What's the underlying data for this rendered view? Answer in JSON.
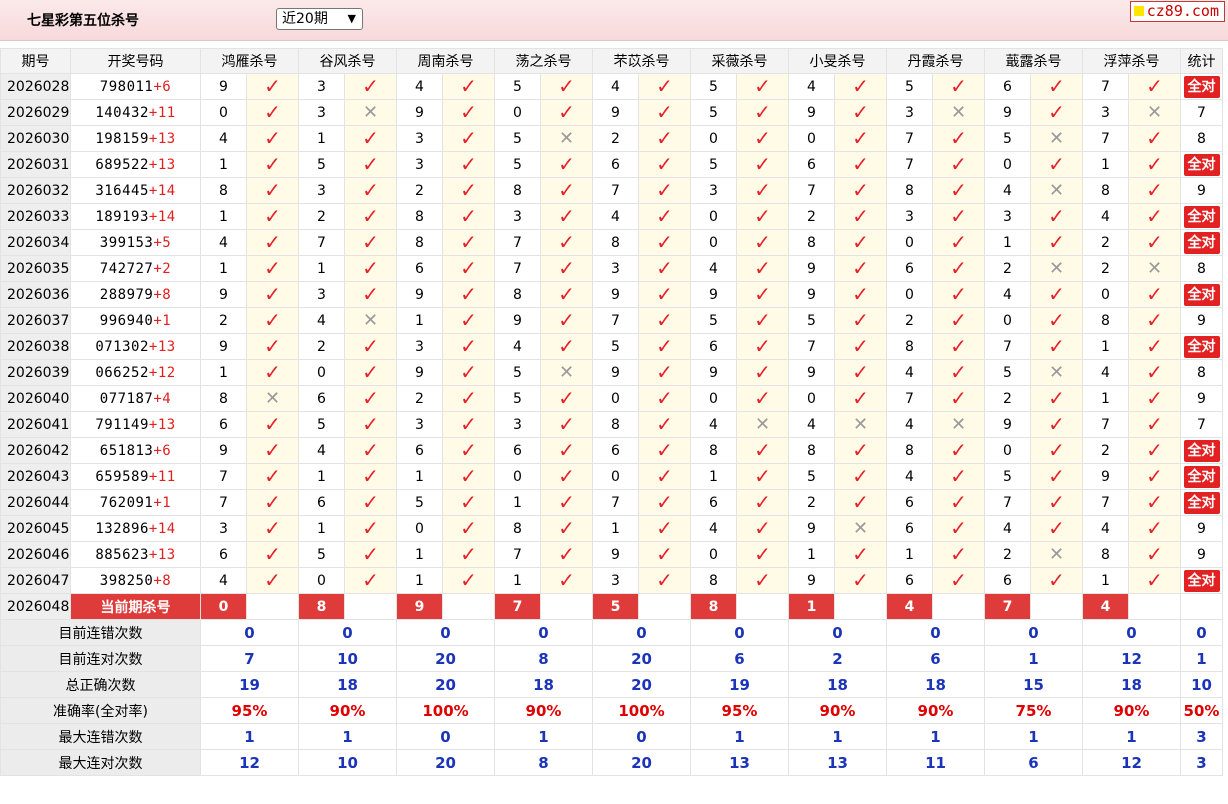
{
  "header": {
    "title": "七星彩第五位杀号",
    "range_select": "近20期",
    "logo_text": "cz89.com"
  },
  "table": {
    "columns": {
      "issue": "期号",
      "draw": "开奖号码",
      "stats": "统计",
      "experts": [
        "鸿雁杀号",
        "谷风杀号",
        "周南杀号",
        "荡之杀号",
        "芣苡杀号",
        "采薇杀号",
        "小旻杀号",
        "丹霞杀号",
        "蕺露杀号",
        "浮萍杀号"
      ]
    },
    "rows": [
      {
        "issue": "2026028",
        "main": "798011",
        "extra": "+6",
        "picks": [
          "9",
          "3",
          "4",
          "5",
          "4",
          "5",
          "4",
          "5",
          "6",
          "7"
        ],
        "marks": [
          "ok",
          "ok",
          "ok",
          "ok",
          "ok",
          "ok",
          "ok",
          "ok",
          "ok",
          "ok"
        ],
        "stat": "全对"
      },
      {
        "issue": "2026029",
        "main": "140432",
        "extra": "+11",
        "picks": [
          "0",
          "3",
          "9",
          "0",
          "9",
          "5",
          "9",
          "3",
          "9",
          "3"
        ],
        "marks": [
          "ok",
          "bad",
          "ok",
          "ok",
          "ok",
          "ok",
          "ok",
          "bad",
          "ok",
          "bad"
        ],
        "stat": "7"
      },
      {
        "issue": "2026030",
        "main": "198159",
        "extra": "+13",
        "picks": [
          "4",
          "1",
          "3",
          "5",
          "2",
          "0",
          "0",
          "7",
          "5",
          "7"
        ],
        "marks": [
          "ok",
          "ok",
          "ok",
          "bad",
          "ok",
          "ok",
          "ok",
          "ok",
          "bad",
          "ok"
        ],
        "stat": "8"
      },
      {
        "issue": "2026031",
        "main": "689522",
        "extra": "+13",
        "picks": [
          "1",
          "5",
          "3",
          "5",
          "6",
          "5",
          "6",
          "7",
          "0",
          "1"
        ],
        "marks": [
          "ok",
          "ok",
          "ok",
          "ok",
          "ok",
          "ok",
          "ok",
          "ok",
          "ok",
          "ok"
        ],
        "stat": "全对"
      },
      {
        "issue": "2026032",
        "main": "316445",
        "extra": "+14",
        "picks": [
          "8",
          "3",
          "2",
          "8",
          "7",
          "3",
          "7",
          "8",
          "4",
          "8"
        ],
        "marks": [
          "ok",
          "ok",
          "ok",
          "ok",
          "ok",
          "ok",
          "ok",
          "ok",
          "bad",
          "ok"
        ],
        "stat": "9"
      },
      {
        "issue": "2026033",
        "main": "189193",
        "extra": "+14",
        "picks": [
          "1",
          "2",
          "8",
          "3",
          "4",
          "0",
          "2",
          "3",
          "3",
          "4"
        ],
        "marks": [
          "ok",
          "ok",
          "ok",
          "ok",
          "ok",
          "ok",
          "ok",
          "ok",
          "ok",
          "ok"
        ],
        "stat": "全对"
      },
      {
        "issue": "2026034",
        "main": "399153",
        "extra": "+5",
        "picks": [
          "4",
          "7",
          "8",
          "7",
          "8",
          "0",
          "8",
          "0",
          "1",
          "2"
        ],
        "marks": [
          "ok",
          "ok",
          "ok",
          "ok",
          "ok",
          "ok",
          "ok",
          "ok",
          "ok",
          "ok"
        ],
        "stat": "全对"
      },
      {
        "issue": "2026035",
        "main": "742727",
        "extra": "+2",
        "picks": [
          "1",
          "1",
          "6",
          "7",
          "3",
          "4",
          "9",
          "6",
          "2",
          "2"
        ],
        "marks": [
          "ok",
          "ok",
          "ok",
          "ok",
          "ok",
          "ok",
          "ok",
          "ok",
          "bad",
          "bad"
        ],
        "stat": "8"
      },
      {
        "issue": "2026036",
        "main": "288979",
        "extra": "+8",
        "picks": [
          "9",
          "3",
          "9",
          "8",
          "9",
          "9",
          "9",
          "0",
          "4",
          "0"
        ],
        "marks": [
          "ok",
          "ok",
          "ok",
          "ok",
          "ok",
          "ok",
          "ok",
          "ok",
          "ok",
          "ok"
        ],
        "stat": "全对"
      },
      {
        "issue": "2026037",
        "main": "996940",
        "extra": "+1",
        "picks": [
          "2",
          "4",
          "1",
          "9",
          "7",
          "5",
          "5",
          "2",
          "0",
          "8"
        ],
        "marks": [
          "ok",
          "bad",
          "ok",
          "ok",
          "ok",
          "ok",
          "ok",
          "ok",
          "ok",
          "ok"
        ],
        "stat": "9"
      },
      {
        "issue": "2026038",
        "main": "071302",
        "extra": "+13",
        "picks": [
          "9",
          "2",
          "3",
          "4",
          "5",
          "6",
          "7",
          "8",
          "7",
          "1"
        ],
        "marks": [
          "ok",
          "ok",
          "ok",
          "ok",
          "ok",
          "ok",
          "ok",
          "ok",
          "ok",
          "ok"
        ],
        "stat": "全对"
      },
      {
        "issue": "2026039",
        "main": "066252",
        "extra": "+12",
        "picks": [
          "1",
          "0",
          "9",
          "5",
          "9",
          "9",
          "9",
          "4",
          "5",
          "4"
        ],
        "marks": [
          "ok",
          "ok",
          "ok",
          "bad",
          "ok",
          "ok",
          "ok",
          "ok",
          "bad",
          "ok"
        ],
        "stat": "8"
      },
      {
        "issue": "2026040",
        "main": "077187",
        "extra": "+4",
        "picks": [
          "8",
          "6",
          "2",
          "5",
          "0",
          "0",
          "0",
          "7",
          "2",
          "1"
        ],
        "marks": [
          "bad",
          "ok",
          "ok",
          "ok",
          "ok",
          "ok",
          "ok",
          "ok",
          "ok",
          "ok"
        ],
        "stat": "9"
      },
      {
        "issue": "2026041",
        "main": "791149",
        "extra": "+13",
        "picks": [
          "6",
          "5",
          "3",
          "3",
          "8",
          "4",
          "4",
          "4",
          "9",
          "7"
        ],
        "marks": [
          "ok",
          "ok",
          "ok",
          "ok",
          "ok",
          "bad",
          "bad",
          "bad",
          "ok",
          "ok"
        ],
        "stat": "7"
      },
      {
        "issue": "2026042",
        "main": "651813",
        "extra": "+6",
        "picks": [
          "9",
          "4",
          "6",
          "6",
          "6",
          "8",
          "8",
          "8",
          "0",
          "2"
        ],
        "marks": [
          "ok",
          "ok",
          "ok",
          "ok",
          "ok",
          "ok",
          "ok",
          "ok",
          "ok",
          "ok"
        ],
        "stat": "全对"
      },
      {
        "issue": "2026043",
        "main": "659589",
        "extra": "+11",
        "picks": [
          "7",
          "1",
          "1",
          "0",
          "0",
          "1",
          "5",
          "4",
          "5",
          "9"
        ],
        "marks": [
          "ok",
          "ok",
          "ok",
          "ok",
          "ok",
          "ok",
          "ok",
          "ok",
          "ok",
          "ok"
        ],
        "stat": "全对"
      },
      {
        "issue": "2026044",
        "main": "762091",
        "extra": "+1",
        "picks": [
          "7",
          "6",
          "5",
          "1",
          "7",
          "6",
          "2",
          "6",
          "7",
          "7"
        ],
        "marks": [
          "ok",
          "ok",
          "ok",
          "ok",
          "ok",
          "ok",
          "ok",
          "ok",
          "ok",
          "ok"
        ],
        "stat": "全对"
      },
      {
        "issue": "2026045",
        "main": "132896",
        "extra": "+14",
        "picks": [
          "3",
          "1",
          "0",
          "8",
          "1",
          "4",
          "9",
          "6",
          "4",
          "4"
        ],
        "marks": [
          "ok",
          "ok",
          "ok",
          "ok",
          "ok",
          "ok",
          "bad",
          "ok",
          "ok",
          "ok"
        ],
        "stat": "9"
      },
      {
        "issue": "2026046",
        "main": "885623",
        "extra": "+13",
        "picks": [
          "6",
          "5",
          "1",
          "7",
          "9",
          "0",
          "1",
          "1",
          "2",
          "8"
        ],
        "marks": [
          "ok",
          "ok",
          "ok",
          "ok",
          "ok",
          "ok",
          "ok",
          "ok",
          "bad",
          "ok"
        ],
        "stat": "9"
      },
      {
        "issue": "2026047",
        "main": "398250",
        "extra": "+8",
        "picks": [
          "4",
          "0",
          "1",
          "1",
          "3",
          "8",
          "9",
          "6",
          "6",
          "1"
        ],
        "marks": [
          "ok",
          "ok",
          "ok",
          "ok",
          "ok",
          "ok",
          "ok",
          "ok",
          "ok",
          "ok"
        ],
        "stat": "全对"
      }
    ],
    "current": {
      "issue": "2026048",
      "label": "当前期杀号",
      "picks": [
        "0",
        "8",
        "9",
        "7",
        "5",
        "8",
        "1",
        "4",
        "7",
        "4"
      ]
    },
    "summary": [
      {
        "label": "目前连错次数",
        "values": [
          "0",
          "0",
          "0",
          "0",
          "0",
          "0",
          "0",
          "0",
          "0",
          "0"
        ],
        "stat": "0",
        "color": "blue"
      },
      {
        "label": "目前连对次数",
        "values": [
          "7",
          "10",
          "20",
          "8",
          "20",
          "6",
          "2",
          "6",
          "1",
          "12"
        ],
        "stat": "1",
        "color": "blue"
      },
      {
        "label": "总正确次数",
        "values": [
          "19",
          "18",
          "20",
          "18",
          "20",
          "19",
          "18",
          "18",
          "15",
          "18"
        ],
        "stat": "10",
        "color": "blue"
      },
      {
        "label": "准确率(全对率)",
        "values": [
          "95%",
          "90%",
          "100%",
          "90%",
          "100%",
          "95%",
          "90%",
          "90%",
          "75%",
          "90%"
        ],
        "stat": "50%",
        "color": "red"
      },
      {
        "label": "最大连错次数",
        "values": [
          "1",
          "1",
          "0",
          "1",
          "0",
          "1",
          "1",
          "1",
          "1",
          "1"
        ],
        "stat": "3",
        "color": "blue"
      },
      {
        "label": "最大连对次数",
        "values": [
          "12",
          "10",
          "20",
          "8",
          "20",
          "13",
          "13",
          "11",
          "6",
          "12"
        ],
        "stat": "3",
        "color": "blue"
      }
    ],
    "mark_glyphs": {
      "ok": "✓",
      "bad": "✕"
    },
    "colors": {
      "ok": "#e8202a",
      "bad": "#9a9a9a",
      "accent": "#e03b3b",
      "blue": "#1c34b8",
      "red": "#e00000"
    }
  }
}
